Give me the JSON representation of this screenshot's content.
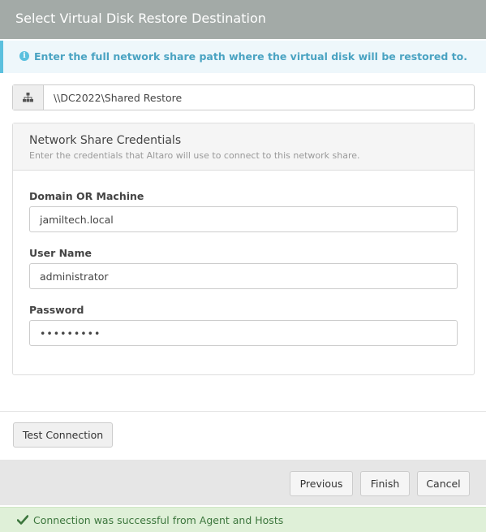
{
  "dialog": {
    "title": "Select Virtual Disk Restore Destination"
  },
  "info": {
    "icon": "info-circle-icon",
    "text": "Enter the full network share path where the virtual disk will be restored to."
  },
  "path": {
    "icon": "network-sitemap-icon",
    "value": "\\\\DC2022\\Shared Restore"
  },
  "credentials": {
    "title": "Network Share Credentials",
    "subtitle": "Enter the credentials that Altaro will use to connect to this network share.",
    "domain_label": "Domain OR Machine",
    "domain_value": "jamiltech.local",
    "username_label": "User Name",
    "username_value": "administrator",
    "password_label": "Password",
    "password_value": "•••••••••"
  },
  "buttons": {
    "test_connection": "Test Connection",
    "previous": "Previous",
    "finish": "Finish",
    "cancel": "Cancel"
  },
  "status": {
    "icon": "checkmark-icon",
    "text": "Connection was successful from Agent and Hosts",
    "color": "#3c763d"
  },
  "colors": {
    "title_bar": "#a3aaa7",
    "info_accent": "#5bc0de",
    "success_bg": "#dff0d8"
  }
}
